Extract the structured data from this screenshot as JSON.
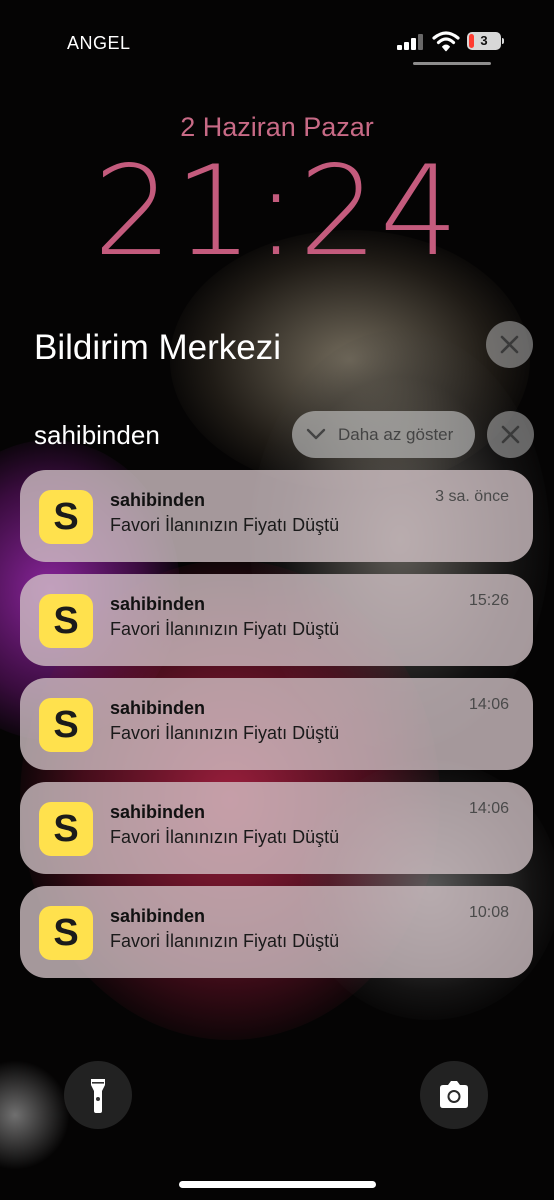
{
  "status_bar": {
    "carrier": "ANGEL",
    "battery_level": "3",
    "icons": [
      "cellular-signal-icon",
      "wifi-icon",
      "battery-icon"
    ]
  },
  "lock_screen": {
    "date": "2 Haziran Pazar",
    "time": "21:24"
  },
  "notification_center": {
    "title": "Bildirim Merkezi",
    "clear_icon": "close-icon",
    "group": {
      "app_name": "sahibinden",
      "show_less_label": "Daha az göster",
      "notifications": [
        {
          "app": "sahibinden",
          "icon_letter": "S",
          "message": "Favori İlanınızın Fiyatı Düştü",
          "time": "3 sa. önce"
        },
        {
          "app": "sahibinden",
          "icon_letter": "S",
          "message": "Favori İlanınızın Fiyatı Düştü",
          "time": "15:26"
        },
        {
          "app": "sahibinden",
          "icon_letter": "S",
          "message": "Favori İlanınızın Fiyatı Düştü",
          "time": "14:06"
        },
        {
          "app": "sahibinden",
          "icon_letter": "S",
          "message": "Favori İlanınızın Fiyatı Düştü",
          "time": "14:06"
        },
        {
          "app": "sahibinden",
          "icon_letter": "S",
          "message": "Favori İlanınızın Fiyatı Düştü",
          "time": "10:08"
        }
      ]
    }
  },
  "quick_actions": [
    "flashlight-icon",
    "camera-icon"
  ],
  "colors": {
    "clock": "#c45b7d",
    "app_icon": "#ffe14d",
    "battery_low": "#ff3b30"
  }
}
